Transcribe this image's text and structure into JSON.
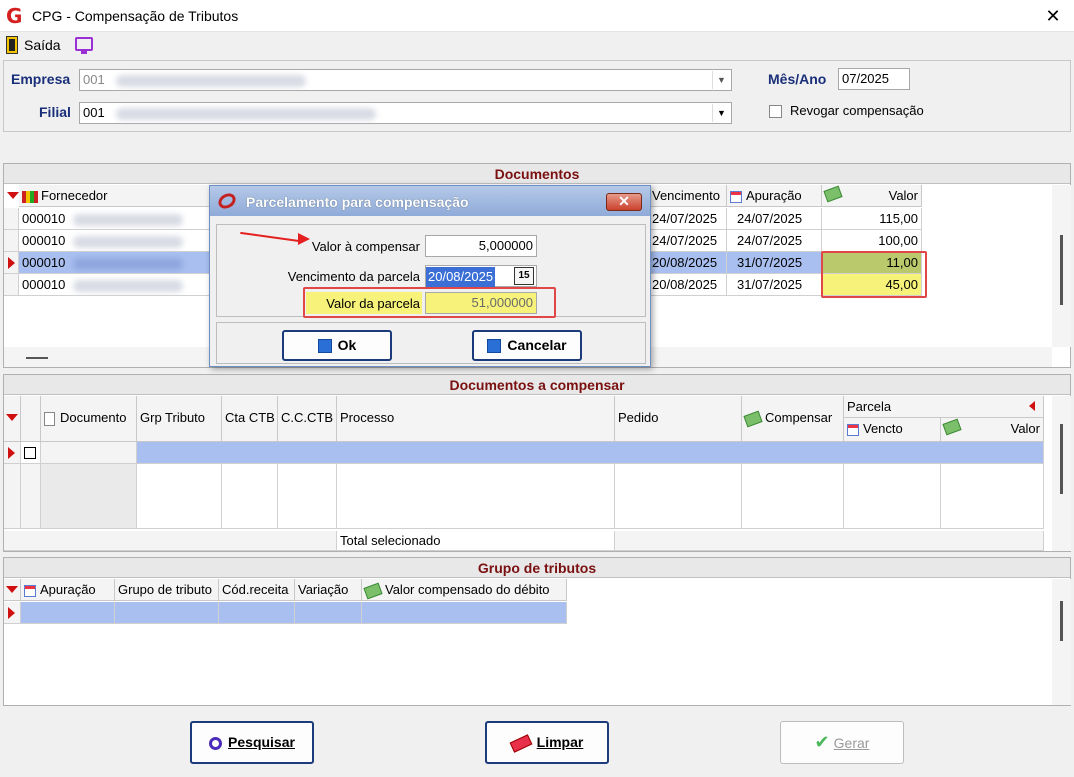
{
  "window": {
    "title": "CPG - Compensação de Tributos",
    "close": "✕",
    "logo": "G"
  },
  "toolbar": {
    "exit_label": "Saída"
  },
  "filters": {
    "empresa_label": "Empresa",
    "empresa_value": "001",
    "filial_label": "Filial",
    "filial_value": "001",
    "mes_ano_label": "Mês/Ano",
    "mes_ano_value": "07/2025",
    "revogar_label": "Revogar compensação"
  },
  "documentos": {
    "title": "Documentos",
    "columns": {
      "fornecedor": "Fornecedor",
      "vencimento": "Vencimento",
      "apuracao": "Apuração",
      "valor": "Valor"
    },
    "rows": [
      {
        "fornecedor": "000010",
        "vencimento": "24/07/2025",
        "apuracao": "24/07/2025",
        "valor": "115,00"
      },
      {
        "fornecedor": "000010",
        "vencimento": "24/07/2025",
        "apuracao": "24/07/2025",
        "valor": "100,00"
      },
      {
        "fornecedor": "000010",
        "vencimento": "20/08/2025",
        "apuracao": "31/07/2025",
        "valor": "11,00"
      },
      {
        "fornecedor": "000010",
        "vencimento": "20/08/2025",
        "apuracao": "31/07/2025",
        "valor": "45,00"
      }
    ]
  },
  "compensar": {
    "title": "Documentos a compensar",
    "columns": {
      "documento": "Documento",
      "grp_tributo": "Grp Tributo",
      "cta_ctb": "Cta CTB",
      "cc_ctb": "C.C.CTB",
      "processo": "Processo",
      "pedido": "Pedido",
      "compensar": "Compensar",
      "parcela": "Parcela",
      "vencto": "Vencto",
      "valor": "Valor"
    },
    "total_label": "Total selecionado"
  },
  "grupo": {
    "title": "Grupo de tributos",
    "columns": {
      "apuracao": "Apuração",
      "grupo": "Grupo de tributo",
      "cod_receita": "Cód.receita",
      "variacao": "Variação",
      "valor_comp": "Valor compensado do débito"
    }
  },
  "buttons": {
    "pesquisar": "Pesquisar",
    "limpar": "Limpar",
    "gerar": "Gerar"
  },
  "dialog": {
    "title": "Parcelamento para compensação",
    "close": "✕",
    "valor_compensar_label": "Valor à compensar",
    "valor_compensar_value": "5,000000",
    "vencimento_label": "Vencimento da parcela",
    "vencimento_value": "20/08/2025",
    "cal_btn": "15",
    "valor_parcela_label": "Valor da parcela",
    "valor_parcela_value": "51,000000",
    "ok": "Ok",
    "cancelar": "Cancelar"
  },
  "colors": {
    "accent": "#1b3b7a",
    "section_title": "#7a1010",
    "selection": "#a9bff0",
    "highlight_yellow": "#f7f27a",
    "highlight_border": "#e04848"
  }
}
